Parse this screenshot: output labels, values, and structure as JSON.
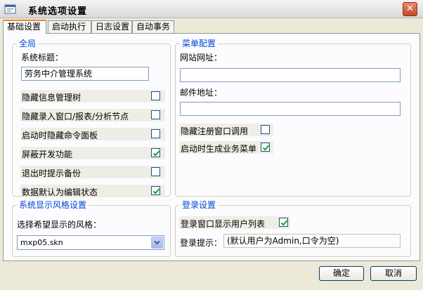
{
  "window": {
    "title": "系统选项设置",
    "close_glyph": "✕"
  },
  "tabs": [
    {
      "label": "基础设置",
      "active": true
    },
    {
      "label": "启动执行",
      "active": false
    },
    {
      "label": "日志设置",
      "active": false
    },
    {
      "label": "自动事务",
      "active": false
    }
  ],
  "global": {
    "title": "全局",
    "system_title_label": "系统标题：",
    "system_title_value": "劳务中介管理系统",
    "options": [
      {
        "label": "隐藏信息管理树",
        "checked": false
      },
      {
        "label": "隐藏录入窗口/报表/分析节点",
        "checked": false
      },
      {
        "label": "启动时隐藏命令面板",
        "checked": false
      },
      {
        "label": "屏蔽开发功能",
        "checked": true
      },
      {
        "label": "退出时提示备份",
        "checked": false
      },
      {
        "label": "数据默认为编辑状态",
        "checked": true
      }
    ]
  },
  "menu_config": {
    "title": "菜单配置",
    "website_label": "网站网址：",
    "website_value": "",
    "email_label": "邮件地址：",
    "email_value": "",
    "options": [
      {
        "label": "隐藏注册窗口调用",
        "checked": false
      },
      {
        "label": "启动时生成业务菜单",
        "checked": true
      }
    ]
  },
  "style": {
    "title": "系统显示风格设置",
    "prompt": "选择希望显示的风格：",
    "selected": "mxp05.skn"
  },
  "login": {
    "title": "登录设置",
    "show_users_label": "登录窗口显示用户列表",
    "show_users_checked": true,
    "hint_label": "登录提示：",
    "hint_value": "(默认用户为Admin,口令为空)"
  },
  "buttons": {
    "ok": "确定",
    "cancel": "取消"
  },
  "colors": {
    "group_title": "#0046d5",
    "active_tab_accent": "#e68b2c",
    "check": "#21a121"
  }
}
